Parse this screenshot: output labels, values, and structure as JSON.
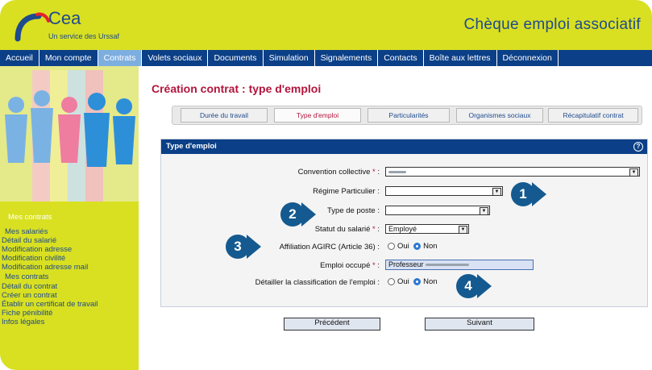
{
  "header": {
    "logo_text": "Cea",
    "logo_subtitle": "Un service des Urssaf",
    "app_title": "Chèque emploi associatif"
  },
  "nav": {
    "items": [
      {
        "label": "Accueil",
        "active": false
      },
      {
        "label": "Mon compte",
        "active": false
      },
      {
        "label": "Contrats",
        "active": true
      },
      {
        "label": "Volets sociaux",
        "active": false
      },
      {
        "label": "Documents",
        "active": false
      },
      {
        "label": "Simulation",
        "active": false
      },
      {
        "label": "Signalements",
        "active": false
      },
      {
        "label": "Contacts",
        "active": false
      },
      {
        "label": "Boîte aux lettres",
        "active": false
      },
      {
        "label": "Déconnexion",
        "active": false
      }
    ]
  },
  "sidebar": {
    "section1_title": "Mes contrats",
    "group1_title": "Mes salariés",
    "group1_items": [
      "Détail du salarié",
      "Modification adresse",
      "Modification civilité",
      "Modification adresse mail"
    ],
    "group2_title": "Mes contrats",
    "group2_items": [
      "Détail du contrat",
      "Créer un contrat",
      "Établir un certificat de travail",
      "Fiche pénibilité",
      "Infos légales"
    ]
  },
  "page": {
    "title": "Création contrat : type d'emploi"
  },
  "steps": [
    {
      "label": "Durée du travail",
      "active": false
    },
    {
      "label": "Type d'emploi",
      "active": true
    },
    {
      "label": "Particularités",
      "active": false
    },
    {
      "label": "Organismes sociaux",
      "active": false
    },
    {
      "label": "Récapitulatif contrat",
      "active": false
    }
  ],
  "form": {
    "panel_title": "Type d'emploi",
    "convention_label": "Convention collective",
    "regime_label": "Régime Particulier :",
    "type_poste_label": "Type de poste :",
    "statut_label": "Statut du salarié",
    "statut_value": "Employé",
    "affiliation_label": "Affiliation AGIRC (Article 36) :",
    "emploi_label": "Emploi occupé",
    "emploi_value": "Professeur",
    "detail_label": "Détailler la classification de l'emploi :",
    "oui": "Oui",
    "non": "Non",
    "required_mark": "*",
    "colon": ":"
  },
  "buttons": {
    "previous": "Précédent",
    "next": "Suivant"
  },
  "callouts": {
    "c1": "1",
    "c2": "2",
    "c3": "3",
    "c4": "4",
    "color": "#145a90"
  },
  "colors": {
    "header_bg": "#d9e021",
    "nav_bg": "#0b3f87",
    "title_red": "#b2153c"
  }
}
